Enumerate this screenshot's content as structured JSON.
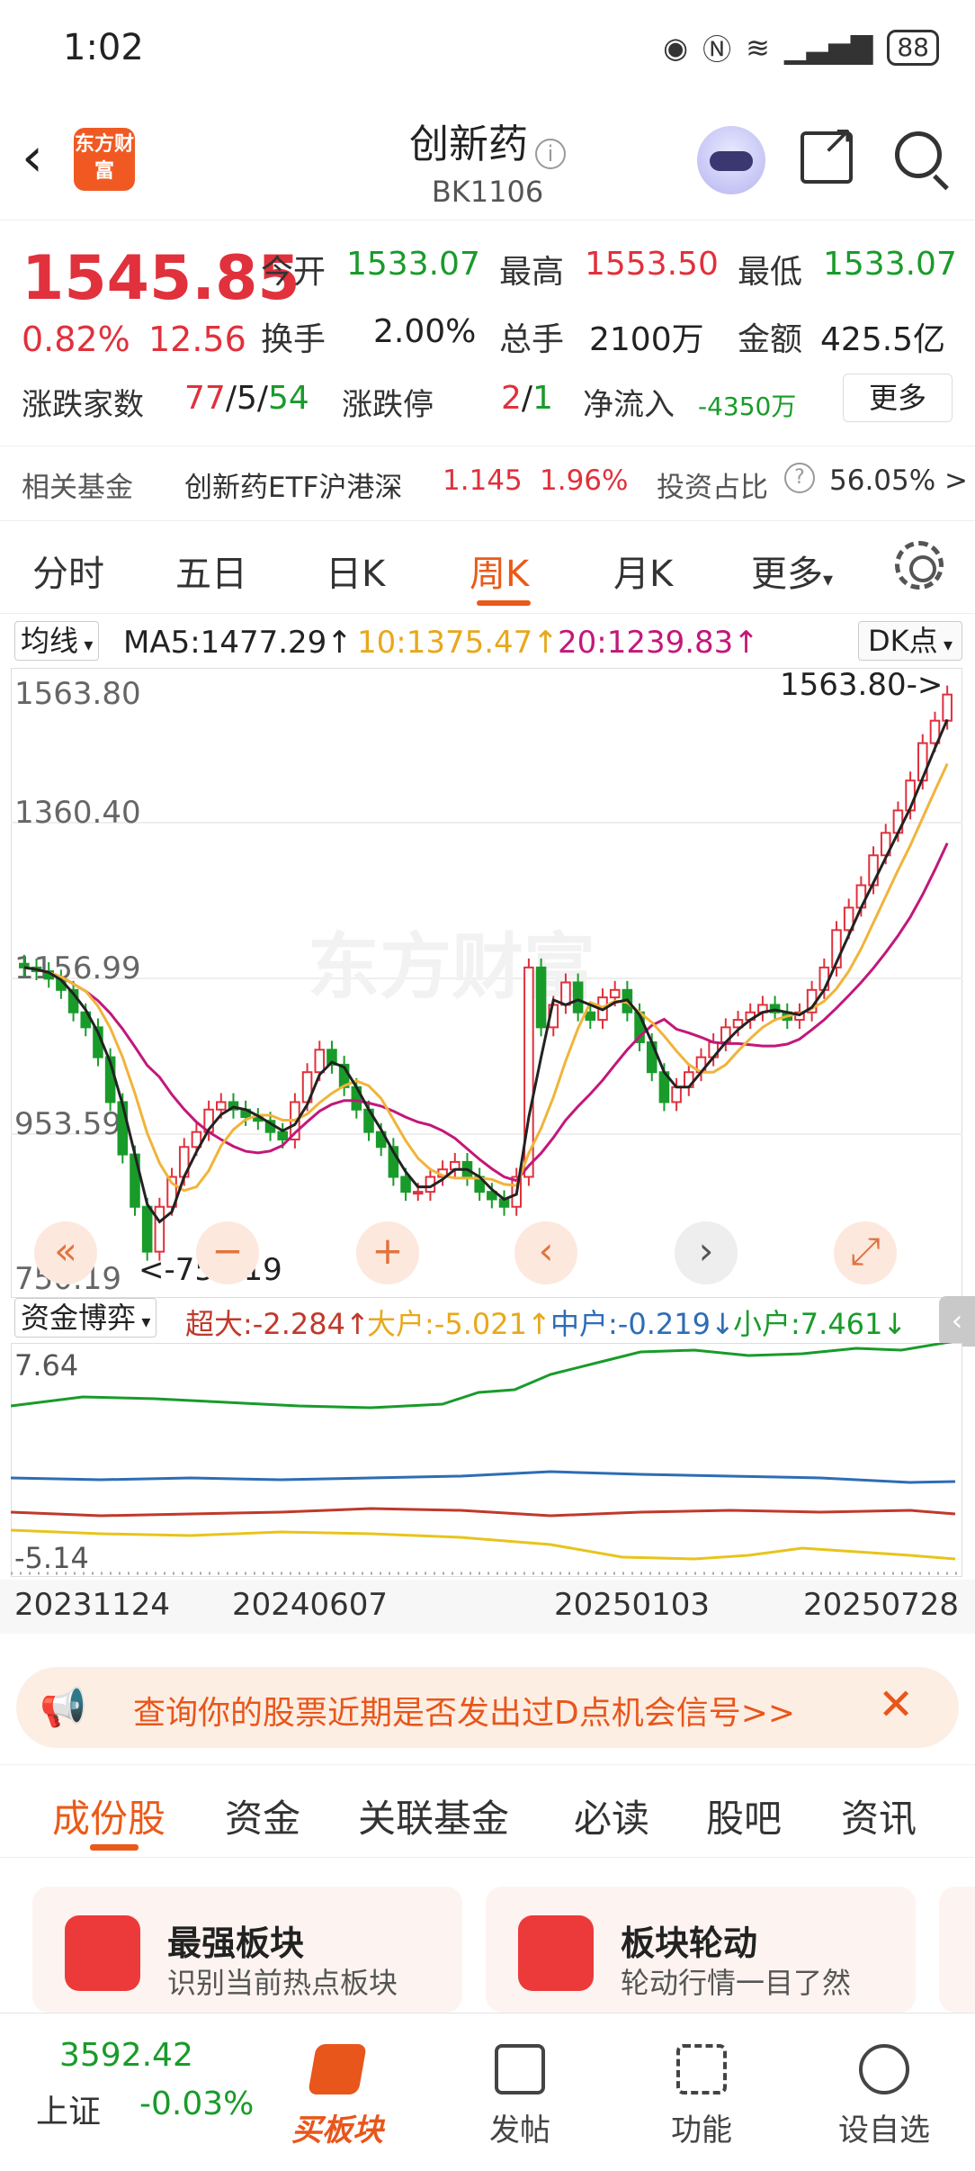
{
  "status": {
    "time": "1:02",
    "battery": "88"
  },
  "header": {
    "logo": "东方财富",
    "title": "创新药",
    "code": "BK1106"
  },
  "quote": {
    "price": "1545.85",
    "change_pct": "0.82%",
    "change": "12.56",
    "open_label": "今开",
    "open": "1533.07",
    "high_label": "最高",
    "high": "1553.50",
    "low_label": "最低",
    "low": "1533.07",
    "turnover_label": "换手",
    "turnover": "2.00%",
    "volume_label": "总手",
    "volume": "2100万",
    "amount_label": "金额",
    "amount": "425.5亿",
    "updown_label": "涨跌家数",
    "up": "77",
    "sep1": "/",
    "flat": "5",
    "sep2": "/",
    "down": "54",
    "limit_label": "涨跌停",
    "limit_up": "2",
    "limit_sep": "/",
    "limit_down": "1",
    "inflow_label": "净流入",
    "inflow": "-4350万",
    "more": "更多"
  },
  "fund": {
    "label": "相关基金",
    "name": "创新药ETF沪港深",
    "price": "1.145",
    "pct": "1.96%",
    "ratio_label": "投资占比",
    "ratio": "56.05% >"
  },
  "tabs": [
    "分时",
    "五日",
    "日K",
    "周K",
    "月K",
    "更多",
    ""
  ],
  "active_tab": "周K",
  "ma": {
    "selector": "均线",
    "ma5": "MA5:1477.29↑",
    "ma10": "10:1375.47↑",
    "ma20": "20:1239.83↑",
    "dk": "DK点"
  },
  "kchart_labels": {
    "y1": "1563.80",
    "y2": "1360.40",
    "y3": "1156.99",
    "y4": "953.59",
    "y5": "750.19",
    "max_note": "1563.80->",
    "min_note": "<-750.19",
    "watermark": "东方财富"
  },
  "controls": [
    "«",
    "−",
    "+",
    "‹",
    "›",
    "⤢"
  ],
  "fundflow": {
    "selector": "资金博弈",
    "super": "超大:-2.284↑",
    "big": "大户:-5.021↑",
    "mid": "中户:-0.219↓",
    "small": "小户:7.461↓",
    "ymax": "7.64",
    "ymin": "-5.14"
  },
  "xaxis": [
    "20231124",
    "20240607",
    "20250103",
    "20250728"
  ],
  "banner": {
    "text": "查询你的股票近期是否发出过D点机会信号>>"
  },
  "content_tabs": [
    "成份股",
    "资金",
    "关联基金",
    "必读",
    "股吧",
    "资讯"
  ],
  "cards": [
    {
      "title": "最强板块",
      "sub": "识别当前热点板块"
    },
    {
      "title": "板块轮动",
      "sub": "轮动行情一目了然"
    }
  ],
  "bottom": {
    "index_value": "3592.42",
    "index_name": "上证",
    "index_pct": "-0.03%",
    "buy": "买板块",
    "post": "发帖",
    "func": "功能",
    "watch": "设自选"
  },
  "chart_data": {
    "type": "candlestick",
    "y_range": [
      750.19,
      1563.8
    ],
    "x_labels": [
      "20231124",
      "20240607",
      "20250103",
      "20250728"
    ],
    "ma": {
      "MA5": 1477.29,
      "MA10": 1375.47,
      "MA20": 1239.83
    },
    "closes": [
      1180,
      1175,
      1165,
      1150,
      1120,
      1100,
      1060,
      1000,
      930,
      860,
      800,
      860,
      900,
      940,
      960,
      990,
      1000,
      990,
      980,
      975,
      960,
      950,
      1000,
      1040,
      1070,
      1050,
      1020,
      990,
      960,
      940,
      900,
      880,
      880,
      900,
      910,
      920,
      900,
      880,
      870,
      860,
      900,
      1180,
      1100,
      1130,
      1160,
      1120,
      1110,
      1140,
      1150,
      1120,
      1080,
      1040,
      1000,
      1020,
      1040,
      1060,
      1080,
      1100,
      1110,
      1120,
      1130,
      1120,
      1110,
      1120,
      1150,
      1180,
      1230,
      1260,
      1290,
      1330,
      1360,
      1390,
      1430,
      1480,
      1510,
      1545
    ]
  }
}
